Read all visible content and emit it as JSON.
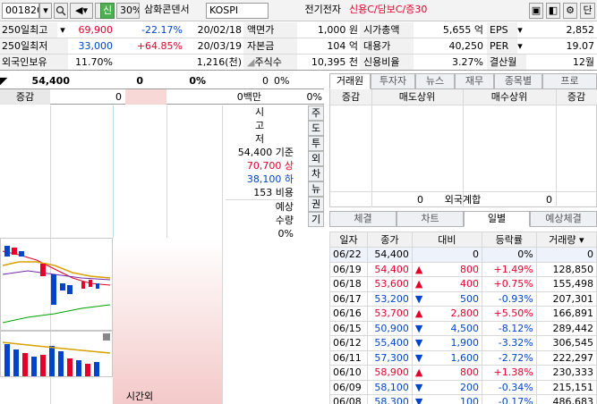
{
  "toolbar": {
    "code": "001820",
    "credit_badge": "신",
    "margin_rate": "30%",
    "company_name": "삼화콘덴서",
    "market": "KOSPI",
    "sector": "전기전자",
    "credit_info": "신용C/담보C/증30",
    "extra_btn": "단"
  },
  "info": {
    "rows": [
      {
        "label": "250일최고",
        "value": "69,900",
        "rate": "-22.17%",
        "date": "20/02/18",
        "k1": "액면가",
        "v1": "1,000 원",
        "k2": "시가총액",
        "v2": "5,655 억",
        "k3": "EPS",
        "v3": "2,852"
      },
      {
        "label": "250일최저",
        "value": "33,000",
        "rate": "+64.85%",
        "date": "20/03/19",
        "k1": "자본금",
        "v1": "104 억",
        "k2": "대용가",
        "v2": "40,250",
        "k3": "PER",
        "v3": "19.07"
      },
      {
        "label": "외국인보유",
        "value": "11.70%",
        "rate": "",
        "date": "1,216(천)",
        "k1": "주식수",
        "v1": "10,395 천",
        "k2": "신용비율",
        "v2": "3.27%",
        "k3": "결산월",
        "v3": "12월"
      }
    ]
  },
  "orderbook": {
    "price": "54,400",
    "vol": "0",
    "pct": "0%",
    "vol2": "0",
    "pct2": "0%",
    "change_label": "증감",
    "change_val": "0",
    "amount": "0",
    "amount_unit": "0백만",
    "amount_pct": "0%",
    "stats": {
      "si": "시",
      "go": "고",
      "jeo": "저",
      "base": "54,400 기준",
      "upper": "70,700 상",
      "lower": "38,100 하",
      "cost": "153 비용",
      "expected": "예상",
      "qty": "수량",
      "qty_pct": "0%"
    },
    "side_btns": [
      "주",
      "도",
      "투",
      "외",
      "차",
      "뉴",
      "권",
      "기"
    ],
    "bottom_label": "시간외"
  },
  "broker": {
    "tabs": [
      "거래원",
      "투자자",
      "뉴스",
      "재무",
      "종목별",
      "프로"
    ],
    "headers": [
      "증감",
      "매도상위",
      "매수상위",
      "증감"
    ],
    "foreign_sell": "0",
    "foreign_label": "외국계합",
    "foreign_buy": "0"
  },
  "lower_tabs": [
    "체결",
    "차트",
    "일별",
    "예상체결"
  ],
  "daily": {
    "headers": [
      "일자",
      "종가",
      "대비",
      "등락률",
      "거래량"
    ],
    "rows": [
      {
        "date": "06/22",
        "close": "54,400",
        "dir": "",
        "diff": "0",
        "rate": "0%",
        "vol": "0",
        "color": "black"
      },
      {
        "date": "06/19",
        "close": "54,400",
        "dir": "▲",
        "diff": "800",
        "rate": "+1.49%",
        "vol": "128,850",
        "color": "red"
      },
      {
        "date": "06/18",
        "close": "53,600",
        "dir": "▲",
        "diff": "400",
        "rate": "+0.75%",
        "vol": "155,498",
        "color": "red"
      },
      {
        "date": "06/17",
        "close": "53,200",
        "dir": "▼",
        "diff": "500",
        "rate": "-0.93%",
        "vol": "207,301",
        "color": "blue"
      },
      {
        "date": "06/16",
        "close": "53,700",
        "dir": "▲",
        "diff": "2,800",
        "rate": "+5.50%",
        "vol": "166,891",
        "color": "red"
      },
      {
        "date": "06/15",
        "close": "50,900",
        "dir": "▼",
        "diff": "4,500",
        "rate": "-8.12%",
        "vol": "289,442",
        "color": "blue"
      },
      {
        "date": "06/12",
        "close": "55,400",
        "dir": "▼",
        "diff": "1,900",
        "rate": "-3.32%",
        "vol": "306,545",
        "color": "blue"
      },
      {
        "date": "06/11",
        "close": "57,300",
        "dir": "▼",
        "diff": "1,600",
        "rate": "-2.72%",
        "vol": "222,297",
        "color": "blue"
      },
      {
        "date": "06/10",
        "close": "58,900",
        "dir": "▲",
        "diff": "800",
        "rate": "+1.38%",
        "vol": "230,333",
        "color": "red"
      },
      {
        "date": "06/09",
        "close": "58,100",
        "dir": "▼",
        "diff": "200",
        "rate": "-0.34%",
        "vol": "215,151",
        "color": "blue"
      },
      {
        "date": "06/08",
        "close": "58,300",
        "dir": "▼",
        "diff": "100",
        "rate": "-0.17%",
        "vol": "486,683",
        "color": "blue"
      }
    ]
  },
  "colors": {
    "up": "#e4002b",
    "down": "#0044cc",
    "label_bg": "#f1f1f1"
  }
}
